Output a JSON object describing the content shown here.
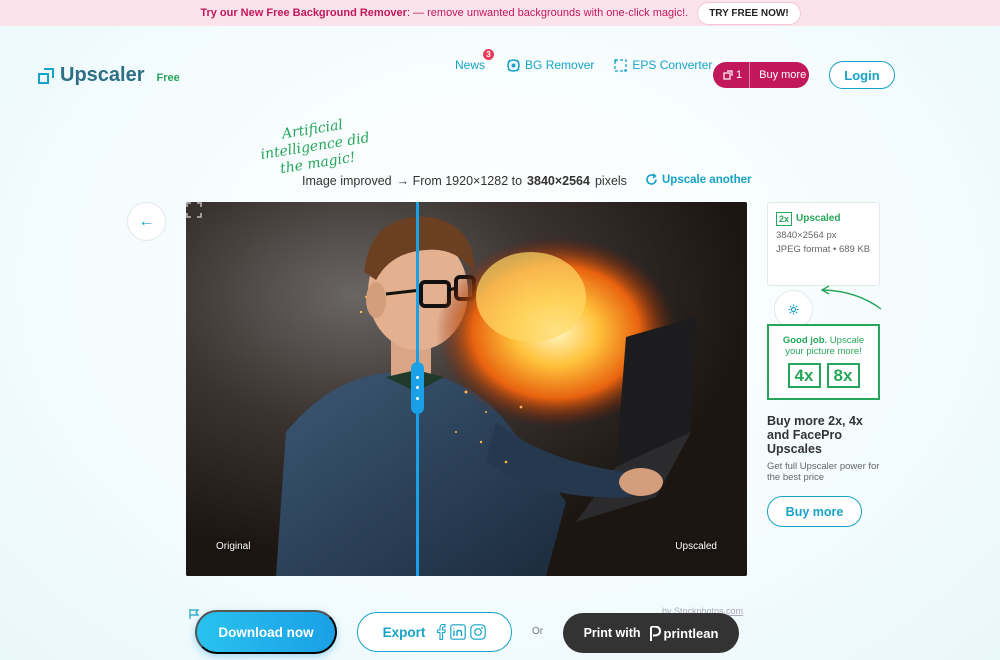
{
  "promo": {
    "bold": "Try our New Free Background Remover",
    "text": ": — remove unwanted backgrounds with one-click magic!.",
    "button": "TRY FREE NOW!"
  },
  "header": {
    "logo": "Upscaler",
    "plan": "Free",
    "nav": {
      "news": "News",
      "news_badge": "3",
      "bg_remover": "BG Remover",
      "eps_converter": "EPS Converter"
    },
    "credits": "1",
    "buy_more": "Buy more",
    "login": "Login"
  },
  "result": {
    "ai_note": "Artificial intelligence did the magic!",
    "improved": "Image improved",
    "from": "→ From 1920×1282 to",
    "to": "3840×2564",
    "unit": "pixels",
    "upscale_another": "Upscale another"
  },
  "compare": {
    "label_original": "Original",
    "label_upscaled": "Upscaled",
    "credit": "by Stockphotos.com"
  },
  "info": {
    "factor_tag": "2x",
    "status": "Upscaled",
    "dimensions": "3840×2564 px",
    "format": "JPEG format • 689 KB"
  },
  "upsell": {
    "bold": "Good job.",
    "text": " Upscale your picture more!",
    "factors": [
      "4x",
      "8x"
    ]
  },
  "buy": {
    "title": "Buy more 2x, 4x and FacePro Upscales",
    "subtitle": "Get full Upscaler power for the best price",
    "button": "Buy more"
  },
  "actions": {
    "download": "Download now",
    "export": "Export",
    "or": "Or",
    "print": "Print with",
    "print_brand": "printlean"
  },
  "colors": {
    "accent": "#17a3c7",
    "brand_pink": "#c2185b",
    "success": "#26a65b"
  }
}
